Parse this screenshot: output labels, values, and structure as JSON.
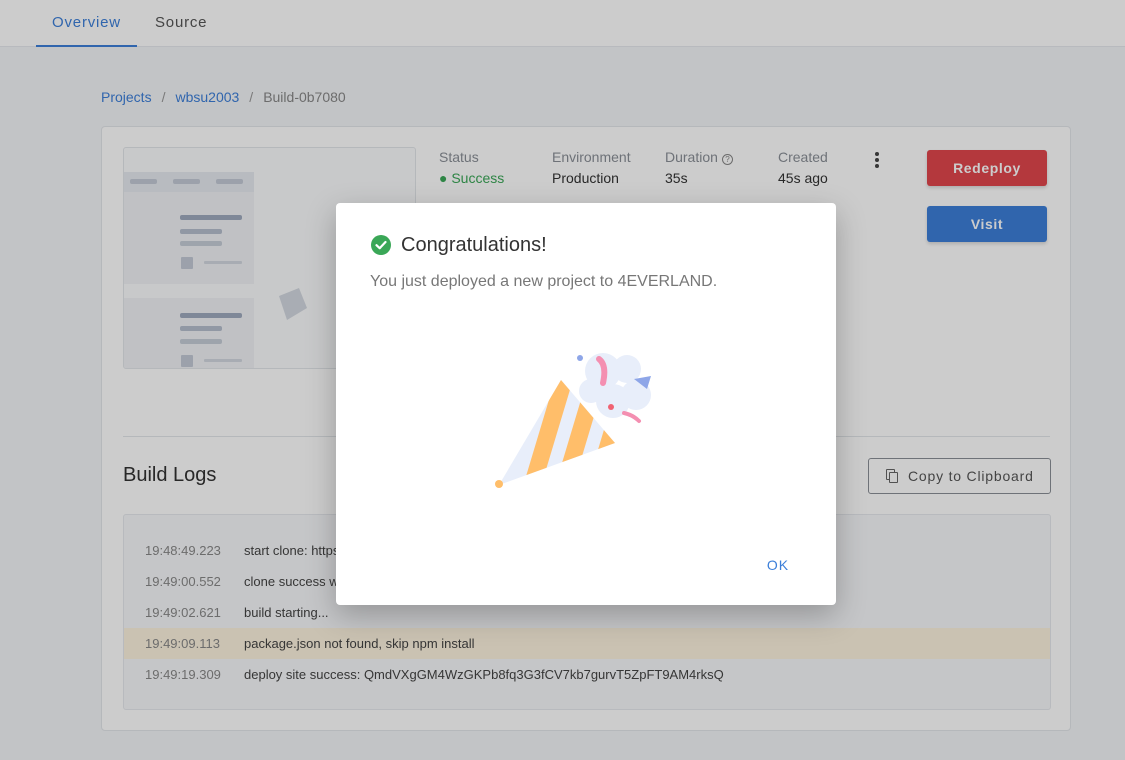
{
  "tabs": [
    {
      "label": "Overview",
      "active": true
    },
    {
      "label": "Source",
      "active": false
    }
  ],
  "breadcrumb": {
    "items": [
      "Projects",
      "wbsu2003",
      "Build-0b7080"
    ],
    "separator": "/"
  },
  "deployment": {
    "status_label": "Status",
    "status_value": "● Success",
    "environment_label": "Environment",
    "environment_value": "Production",
    "duration_label": "Duration",
    "duration_value": "35s",
    "created_label": "Created",
    "created_value": "45s ago"
  },
  "actions": {
    "redeploy_label": "Redeploy",
    "visit_label": "Visit"
  },
  "logs": {
    "title": "Build Logs",
    "copy_label": "Copy to Clipboard",
    "rows": [
      {
        "time": "19:48:49.223",
        "message": "start clone: https://github.com/wbsu2003/...",
        "highlight": false
      },
      {
        "time": "19:49:00.552",
        "message": "clone success with ...",
        "highlight": false
      },
      {
        "time": "19:49:02.621",
        "message": "build starting...",
        "highlight": false
      },
      {
        "time": "19:49:09.113",
        "message": "package.json not found, skip npm install",
        "highlight": true
      },
      {
        "time": "19:49:19.309",
        "message": "deploy site success: QmdVXgGM4WzGKPb8fq3G3fCV7kb7gurvT5ZpFT9AM4rksQ",
        "highlight": false
      }
    ]
  },
  "modal": {
    "title": "Congratulations!",
    "message": "You just deployed a new project to 4EVERLAND.",
    "ok_label": "OK",
    "icon": "check-circle-icon",
    "illustration": "party-popper-icon"
  },
  "colors": {
    "accent": "#3c7fd9",
    "danger": "#e2464d",
    "success": "#3aa757",
    "log_highlight": "#fdf3df"
  }
}
